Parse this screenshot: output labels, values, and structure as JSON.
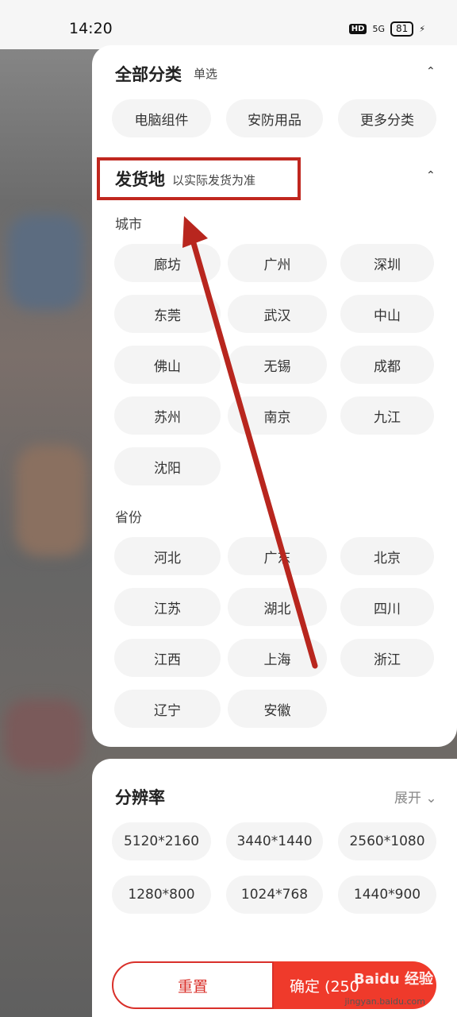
{
  "status_bar": {
    "time": "14:20",
    "hd": "HD",
    "network": "5G",
    "battery": "81"
  },
  "category": {
    "title": "全部分类",
    "subtitle": "单选",
    "chips": [
      "电脑组件",
      "安防用品",
      "更多分类"
    ]
  },
  "shipping": {
    "title": "发货地",
    "subtitle": "以实际发货为准",
    "city_label": "城市",
    "cities": [
      "廊坊",
      "广州",
      "深圳",
      "东莞",
      "武汉",
      "中山",
      "佛山",
      "无锡",
      "成都",
      "苏州",
      "南京",
      "九江",
      "沈阳"
    ],
    "province_label": "省份",
    "provinces": [
      "河北",
      "广东",
      "北京",
      "江苏",
      "湖北",
      "四川",
      "江西",
      "上海",
      "浙江",
      "辽宁",
      "安徽"
    ]
  },
  "resolution": {
    "title": "分辨率",
    "expand_label": "展开",
    "options": [
      "5120*2160",
      "3440*1440",
      "2560*1080",
      "1280*800",
      "1024*768",
      "1440*900"
    ]
  },
  "footer": {
    "reset_label": "重置",
    "confirm_label": "确定 (250",
    "watermark": "Baidu 经验",
    "watermark_url": "jingyan.baidu.com"
  },
  "colors": {
    "accent": "#ef3a2b",
    "highlight": "#c0271f"
  }
}
